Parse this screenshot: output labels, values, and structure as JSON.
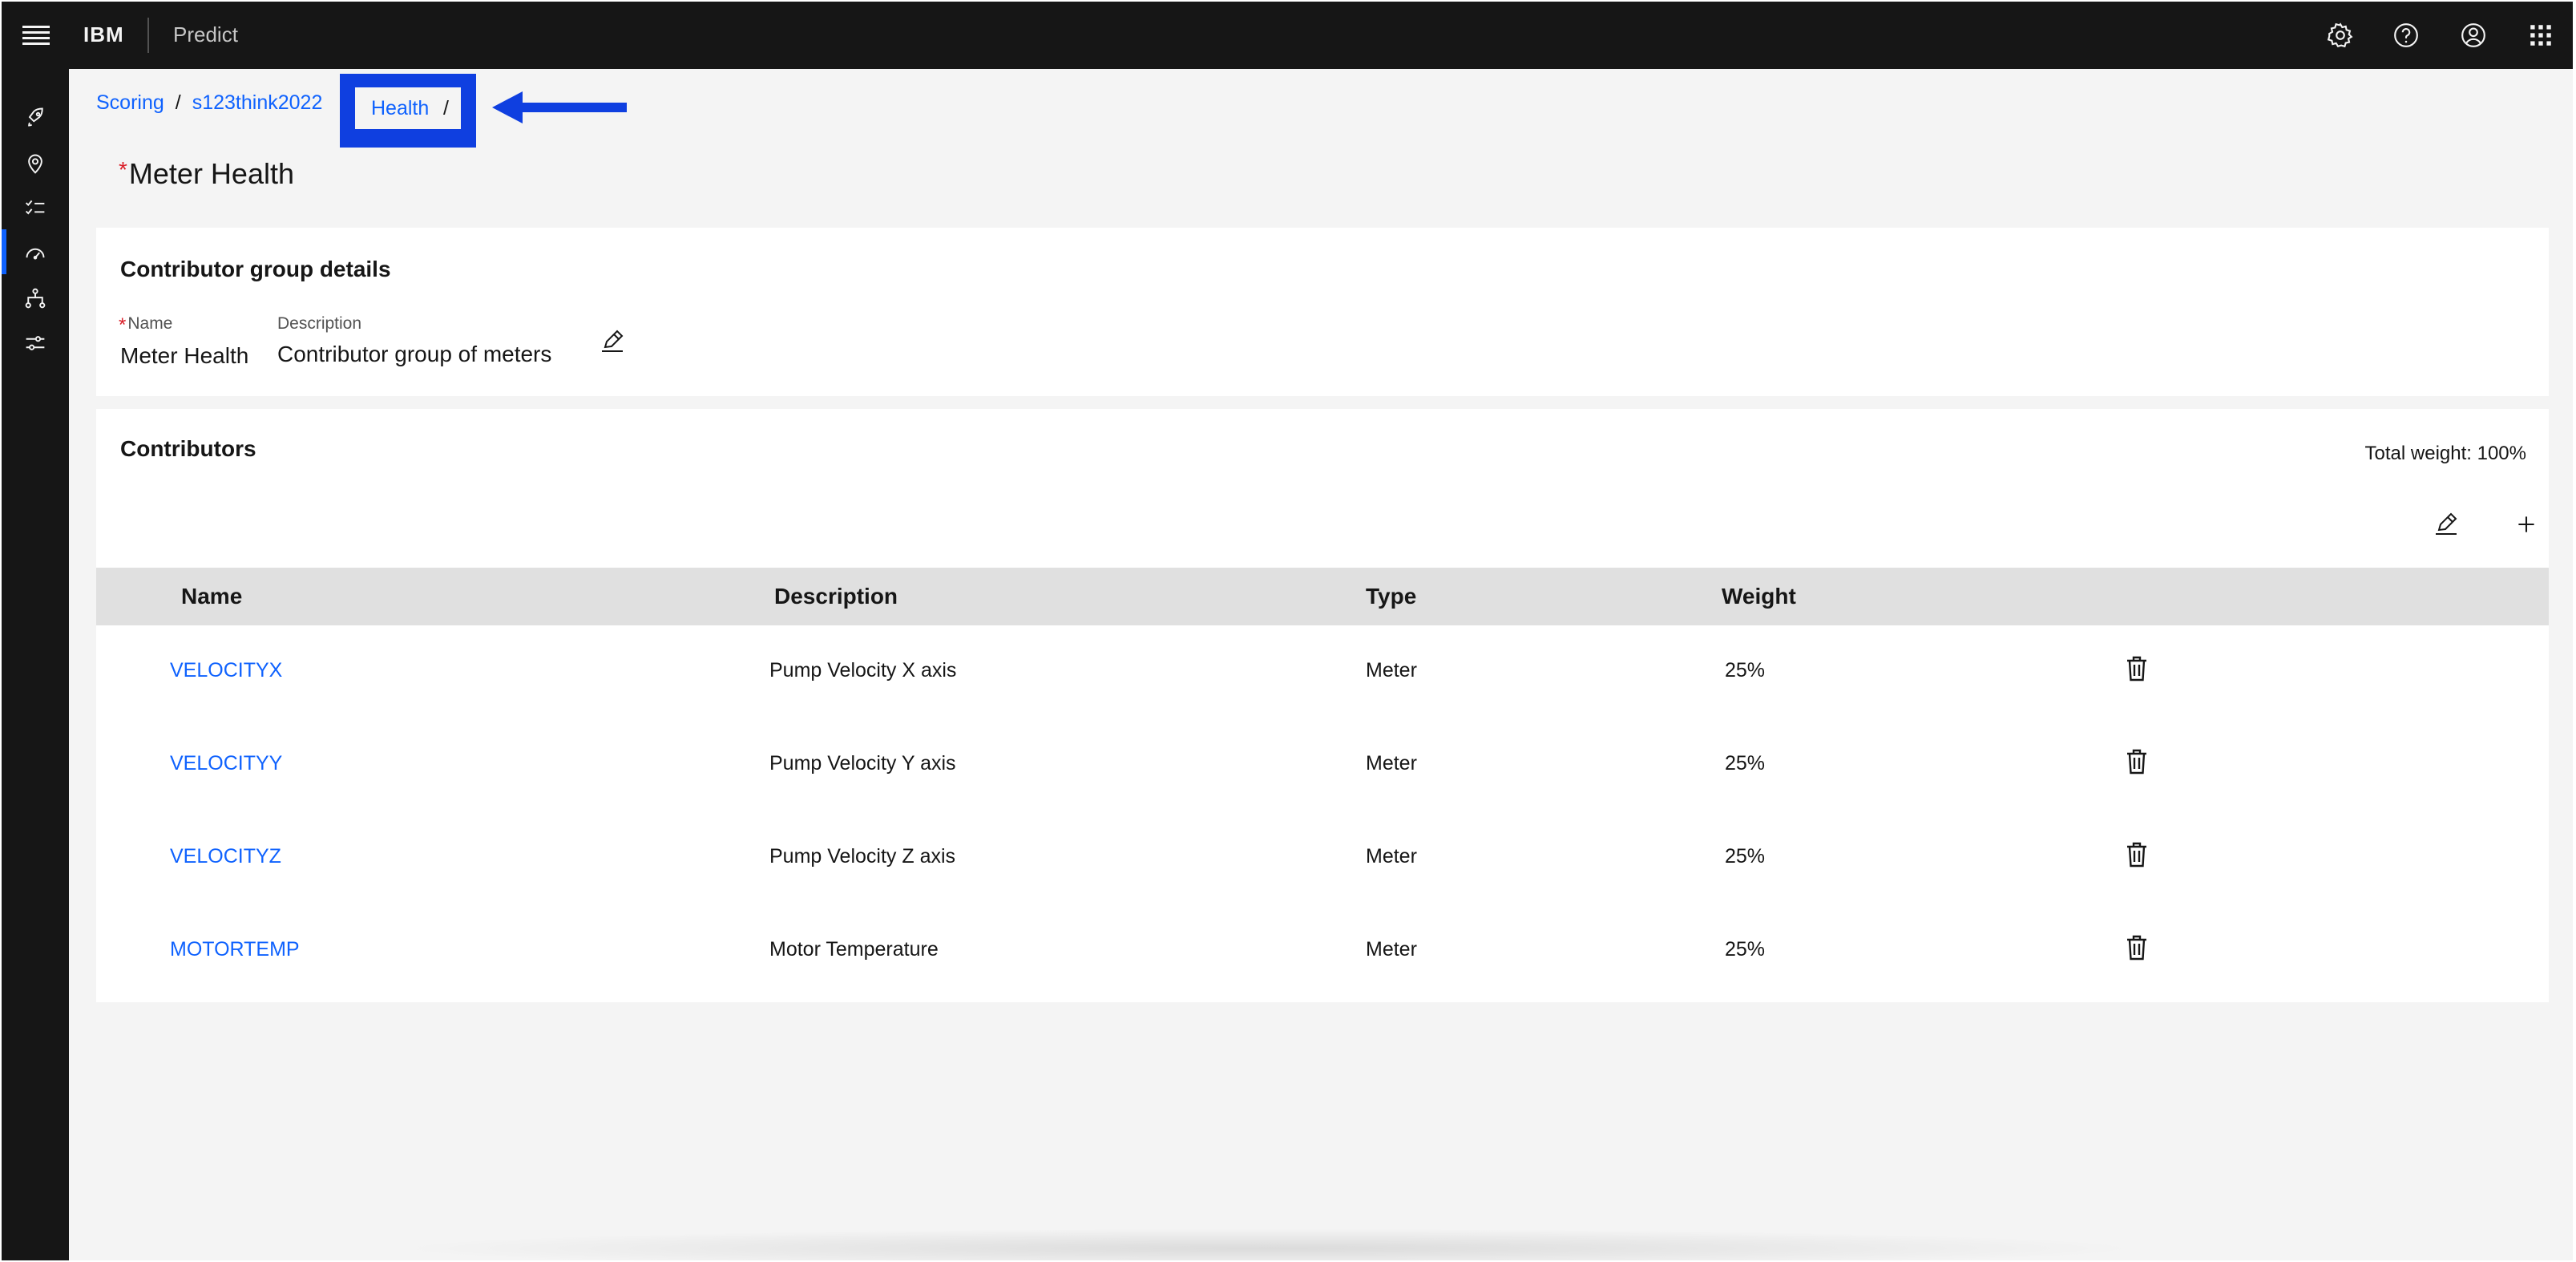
{
  "header": {
    "brand": "IBM",
    "product": "Predict",
    "icons": [
      "menu-icon",
      "settings-icon",
      "help-icon",
      "user-icon",
      "app-switcher-icon"
    ]
  },
  "sidenav": {
    "icons": [
      "rocket-icon",
      "location-icon",
      "checklist-icon",
      "dashboard-gauge-icon",
      "hierarchy-icon",
      "sliders-icon"
    ],
    "active_index": 3
  },
  "breadcrumb": {
    "items": [
      "Scoring",
      "s123think2022",
      "Health"
    ],
    "separator": "/"
  },
  "page": {
    "required_mark": "*",
    "title": "Meter Health"
  },
  "group_details": {
    "title": "Contributor group details",
    "name_label": "Name",
    "name_value": "Meter Health",
    "description_label": "Description",
    "description_value": "Contributor group of meters"
  },
  "contributors": {
    "title": "Contributors",
    "total_weight": "Total weight: 100%",
    "columns": [
      "Name",
      "Description",
      "Type",
      "Weight"
    ],
    "rows": [
      {
        "name": "VELOCITYX",
        "description": "Pump Velocity X axis",
        "type": "Meter",
        "weight": "25%"
      },
      {
        "name": "VELOCITYY",
        "description": "Pump Velocity Y axis",
        "type": "Meter",
        "weight": "25%"
      },
      {
        "name": "VELOCITYZ",
        "description": "Pump Velocity Z axis",
        "type": "Meter",
        "weight": "25%"
      },
      {
        "name": "MOTORTEMP",
        "description": "Motor Temperature",
        "type": "Meter",
        "weight": "25%"
      }
    ]
  },
  "colors": {
    "link": "#0f62fe",
    "header_bg": "#161616",
    "annotation": "#0f3fe0",
    "required": "#da1e28"
  }
}
